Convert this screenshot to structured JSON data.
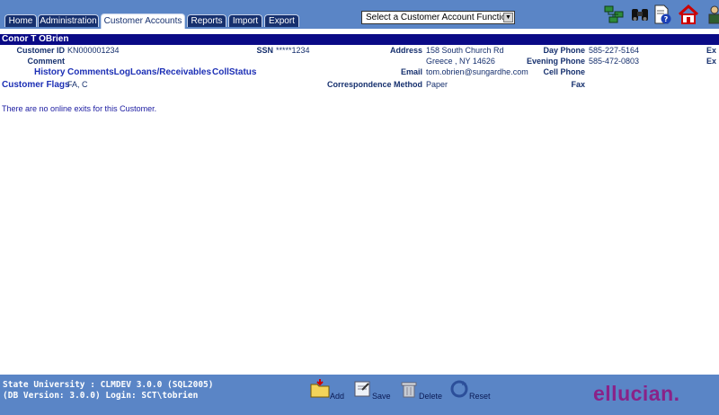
{
  "tabs": [
    "Home",
    "Administration",
    "Customer Accounts",
    "Reports",
    "Import",
    "Export"
  ],
  "active_tab": "Customer Accounts",
  "function_select": {
    "value": "Select a Customer Account Function"
  },
  "toolbar_icons": [
    "tree-icon",
    "binoculars-icon",
    "help-document-icon",
    "home-icon",
    "person-icon"
  ],
  "customer": {
    "name": "Conor T OBrien",
    "customer_id_label": "Customer ID",
    "customer_id": "KN000001234",
    "ssn_label": "SSN",
    "ssn": "*****1234",
    "comment_label": "Comment",
    "address_label": "Address",
    "address_line1": "158 South Church Rd",
    "address_line2": "Greece , NY 14626",
    "email_label": "Email",
    "email": "tom.obrien@sungardhe.com",
    "correspondence_label": "Correspondence Method",
    "correspondence": "Paper",
    "day_phone_label": "Day Phone",
    "day_phone": "585-227-5164",
    "evening_phone_label": "Evening Phone",
    "evening_phone": "585-472-0803",
    "cell_phone_label": "Cell Phone",
    "fax_label": "Fax",
    "ext1": "Ex",
    "ext2": "Ex",
    "flags_label": "Customer Flags",
    "flags": "FA, C"
  },
  "links": {
    "history": "History",
    "comments_log": "CommentsLog",
    "loans": "Loans/Receivables",
    "coll_status": "CollStatus"
  },
  "message": "There are no online exits for this Customer.",
  "footer": {
    "line1": "State University : CLMDEV 3.0.0 (SQL2005)",
    "line2": "(DB Version: 3.0.0) Login: SCT\\tobrien",
    "buttons": {
      "add": "Add",
      "save": "Save",
      "delete": "Delete",
      "reset": "Reset"
    },
    "brand": "ellucian."
  },
  "colors": {
    "header": "#5a85c6",
    "tab": "#16306e",
    "name_bar": "#0a0a86",
    "link": "#1c2fb5",
    "brand": "#8a2288"
  }
}
